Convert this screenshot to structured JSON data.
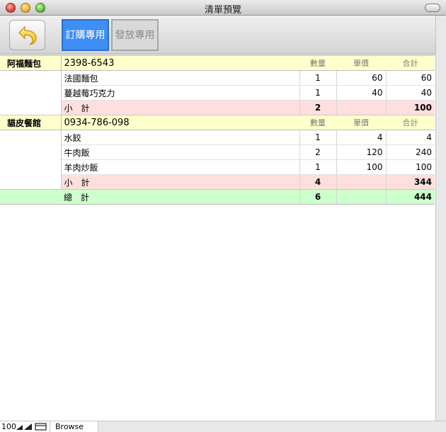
{
  "window": {
    "title": "清單預覽"
  },
  "toolbar": {
    "back_icon": "undo-arrow-icon",
    "order_label": "訂購專用",
    "issue_label": "發放專用"
  },
  "columns": {
    "qty": "數量",
    "price": "單價",
    "total": "合計"
  },
  "vendors": [
    {
      "name": "阿福麵包",
      "phone": "2398-6543",
      "items": [
        {
          "name": "法國麵包",
          "qty": "1",
          "price": "60",
          "total": "60"
        },
        {
          "name": "蔓越莓巧克力",
          "qty": "1",
          "price": "40",
          "total": "40"
        }
      ],
      "subtotal_label": "小　計",
      "subtotal_qty": "2",
      "subtotal_total": "100"
    },
    {
      "name": "貓皮餐館",
      "phone": "0934-786-098",
      "items": [
        {
          "name": "水餃",
          "qty": "1",
          "price": "4",
          "total": "4"
        },
        {
          "name": "牛肉飯",
          "qty": "2",
          "price": "120",
          "total": "240"
        },
        {
          "name": "羊肉炒飯",
          "qty": "1",
          "price": "100",
          "total": "100"
        }
      ],
      "subtotal_label": "小　計",
      "subtotal_qty": "4",
      "subtotal_total": "344"
    }
  ],
  "grand_total": {
    "label": "總　計",
    "qty": "6",
    "total": "444"
  },
  "status": {
    "zoom": "100",
    "mode": "Browse"
  },
  "colors": {
    "vendor_bg": "#ffffcc",
    "subtotal_bg": "#ffdede",
    "total_bg": "#ccffcc",
    "order_button": "#3d8ef5"
  }
}
